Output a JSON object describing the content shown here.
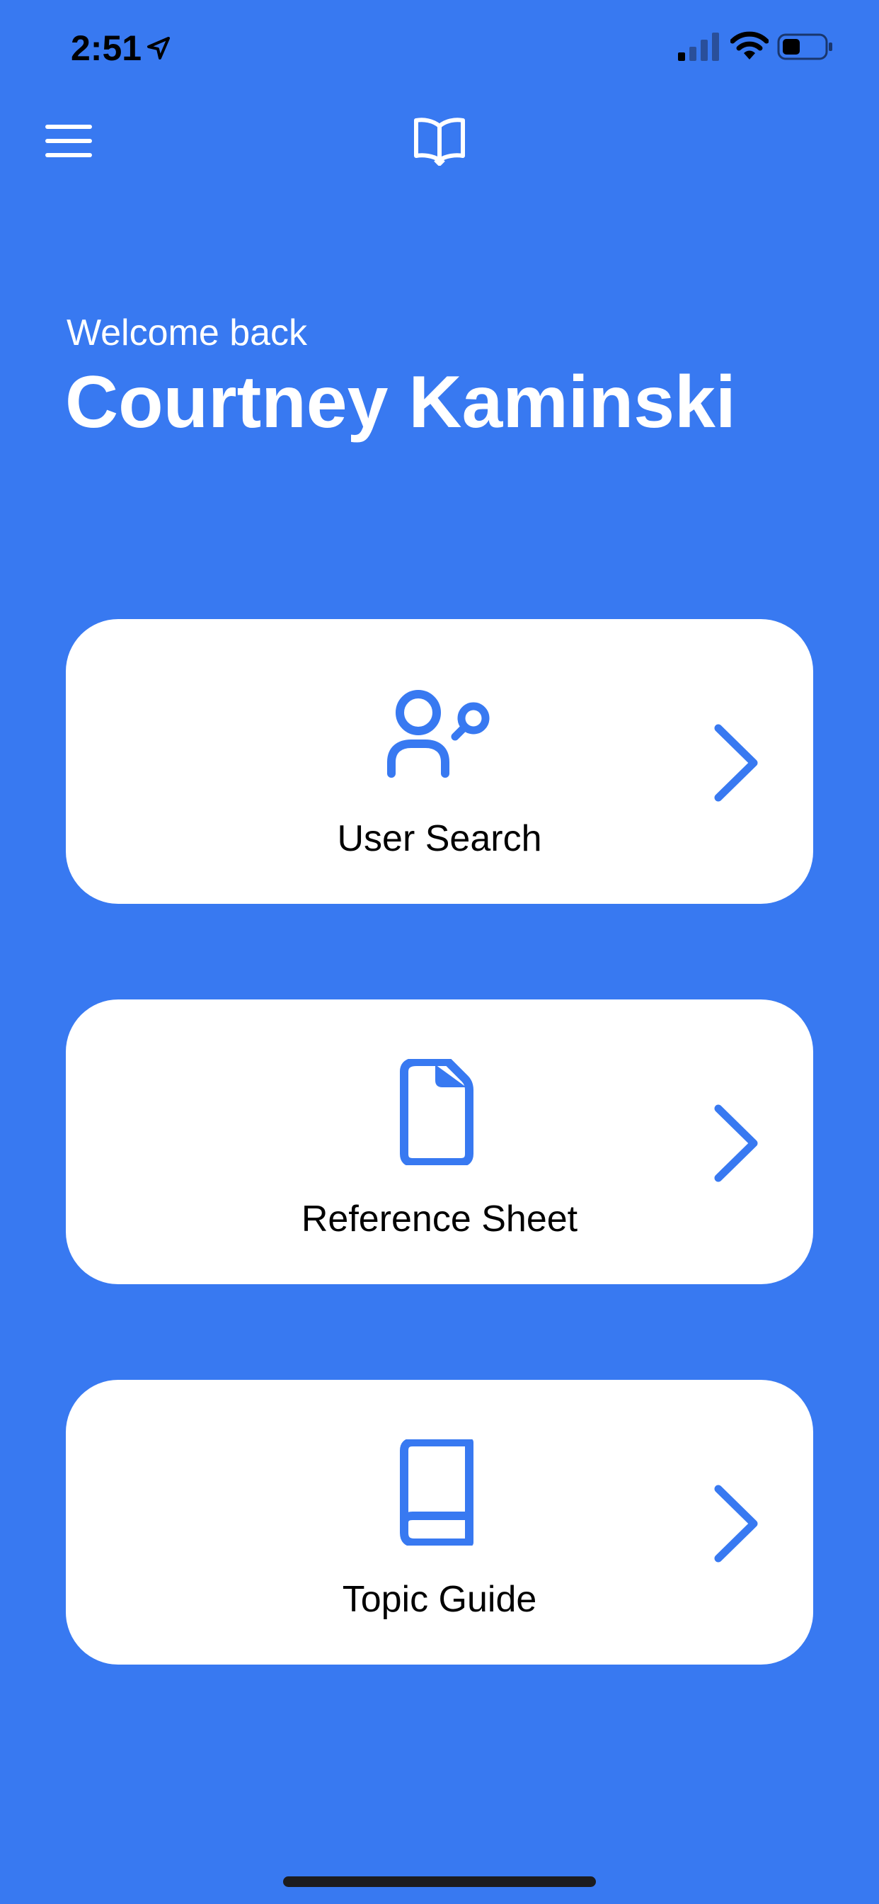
{
  "status_bar": {
    "time": "2:51",
    "icons": [
      "location-arrow-icon",
      "signal-icon",
      "wifi-icon",
      "battery-icon"
    ]
  },
  "nav": {
    "menu_icon": "hamburger-menu-icon",
    "center_icon": "book-open-icon"
  },
  "welcome": {
    "greeting": "Welcome back",
    "name": "Courtney Kaminski"
  },
  "cards": [
    {
      "label": "User Search",
      "icon": "user-search-icon"
    },
    {
      "label": "Reference Sheet",
      "icon": "document-icon"
    },
    {
      "label": "Topic Guide",
      "icon": "book-icon"
    }
  ],
  "colors": {
    "background": "#3879F1",
    "accent": "#3879F1",
    "card": "#FFFFFF",
    "card_text": "#000000"
  }
}
